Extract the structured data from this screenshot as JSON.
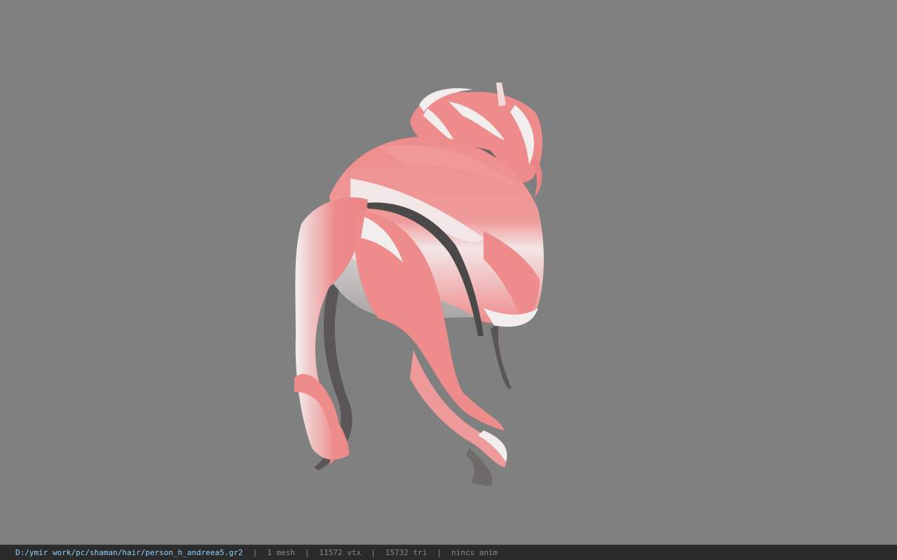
{
  "viewport": {
    "background_color": "#808080",
    "model_icon": "hair-mesh-model",
    "hair_primary_color": "#ee8c8c",
    "hair_highlight_color": "#f2eeee",
    "hair_shadow_color": "#5a5656"
  },
  "status_bar": {
    "file_path": "D:/ymir work/pc/shaman/hair/person_h_andreea5.gr2",
    "separator": "|",
    "mesh_count": "1 mesh",
    "vertex_count": "11572 vtx",
    "triangle_count": "15732 tri",
    "animation": "nincs anim",
    "path_color": "#8fd3ff",
    "stat_color": "#8a8a8a"
  }
}
